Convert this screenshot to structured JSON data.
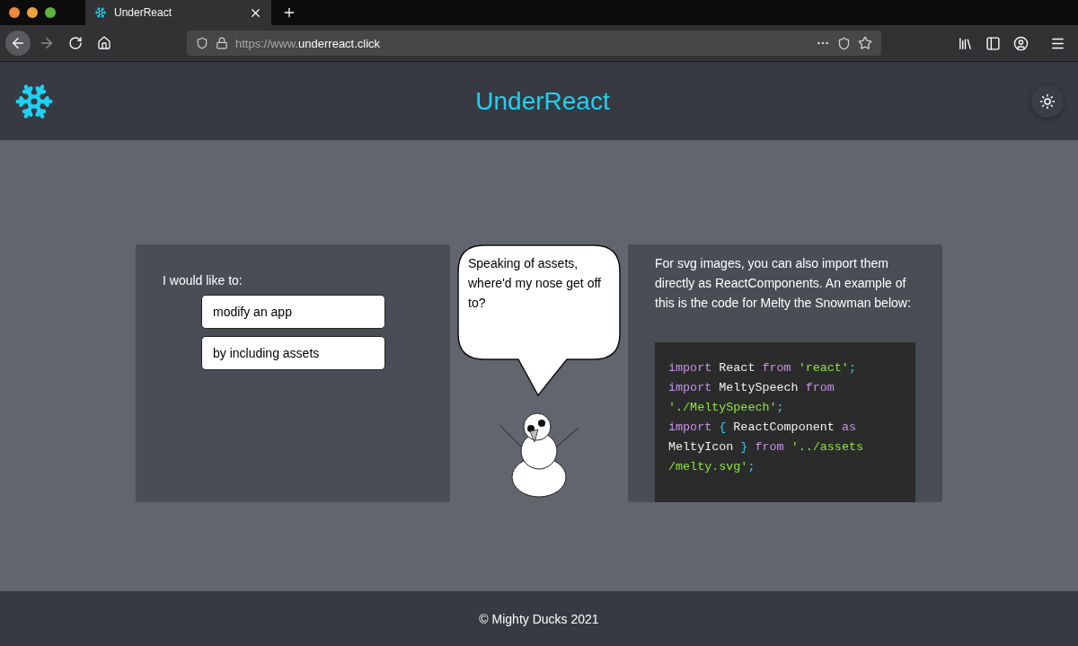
{
  "browser": {
    "tab": {
      "title": "UnderReact",
      "selected": true
    },
    "url": {
      "prefix": "https://www.",
      "domain": "underreact.click"
    }
  },
  "header": {
    "title": "UnderReact"
  },
  "prompt_card": {
    "label": "I would like to:",
    "options": [
      "modify an app",
      "by including assets"
    ]
  },
  "speech_bubble": {
    "text": "Speaking of assets, where'd my nose get off to?"
  },
  "info_card": {
    "text": "For svg images, you can also import them directly as ReactComponents. An example of this is the code for Melty the Snowman below:",
    "code_lines": [
      [
        {
          "text": "import",
          "kind": "keyword"
        },
        {
          "text": " React ",
          "kind": "plain"
        },
        {
          "text": "from",
          "kind": "keyword"
        },
        {
          "text": " 'react'",
          "kind": "string"
        },
        {
          "text": ";",
          "kind": "punct"
        }
      ],
      [
        {
          "text": "import",
          "kind": "keyword"
        },
        {
          "text": " MeltySpeech ",
          "kind": "plain"
        },
        {
          "text": "from",
          "kind": "keyword"
        }
      ],
      [
        {
          "text": "'./MeltySpeech'",
          "kind": "string"
        },
        {
          "text": ";",
          "kind": "punct"
        }
      ],
      [
        {
          "text": "import",
          "kind": "keyword"
        },
        {
          "text": " { ",
          "kind": "punct"
        },
        {
          "text": "ReactComponent ",
          "kind": "plain"
        },
        {
          "text": "as",
          "kind": "keyword"
        }
      ],
      [
        {
          "text": "MeltyIcon ",
          "kind": "plain"
        },
        {
          "text": "} ",
          "kind": "punct"
        },
        {
          "text": "from",
          "kind": "keyword"
        },
        {
          "text": " '../assets",
          "kind": "string"
        }
      ],
      [
        {
          "text": "/melty.svg'",
          "kind": "string"
        },
        {
          "text": ";",
          "kind": "punct"
        }
      ]
    ]
  },
  "footer": {
    "text": "© Mighty Ducks 2021"
  }
}
